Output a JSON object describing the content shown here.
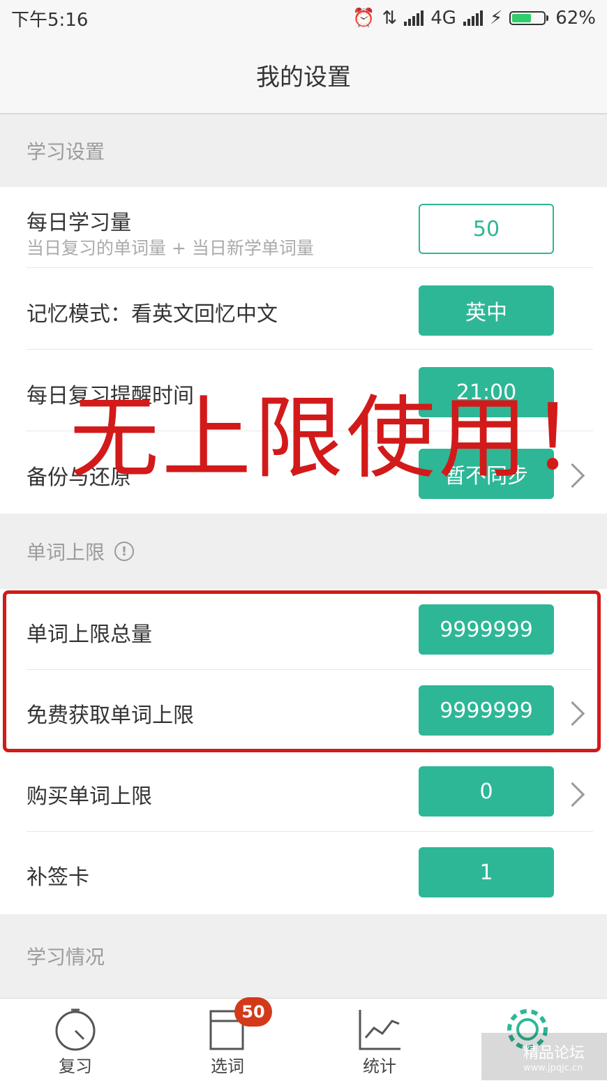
{
  "statusbar": {
    "time": "下午5:16",
    "network": "4G",
    "battery": "62%",
    "battery_level": 0.62
  },
  "header": {
    "title": "我的设置"
  },
  "sections": {
    "study": "学习设置",
    "word_limit": "单词上限",
    "study_status": "学习情况"
  },
  "study_rows": {
    "daily_amount": {
      "label": "每日学习量",
      "sublabel": "当日复习的单词量 + 当日新学单词量",
      "value": "50"
    },
    "memory_mode": {
      "label": "记忆模式：看英文回忆中文",
      "value": "英中"
    },
    "reminder": {
      "label": "每日复习提醒时间",
      "value": "21:00"
    },
    "backup": {
      "label": "备份与还原",
      "value": "暂不同步"
    }
  },
  "limit_rows": {
    "total": {
      "label": "单词上限总量",
      "value": "9999999"
    },
    "free": {
      "label": "免费获取单词上限",
      "value": "9999999"
    },
    "buy": {
      "label": "购买单词上限",
      "value": "0"
    },
    "makeup_card": {
      "label": "补签卡",
      "value": "1"
    }
  },
  "overlay": {
    "text": "无上限使用！"
  },
  "tabs": [
    {
      "label": "复习"
    },
    {
      "label": "选词",
      "badge": "50"
    },
    {
      "label": "统计"
    },
    {
      "label": ""
    }
  ],
  "watermark": {
    "text": "精品论坛",
    "sub": "www.jpqjc.cn"
  },
  "colors": {
    "accent": "#2db796",
    "highlight": "#d21a1a",
    "badge": "#d23a1a"
  }
}
